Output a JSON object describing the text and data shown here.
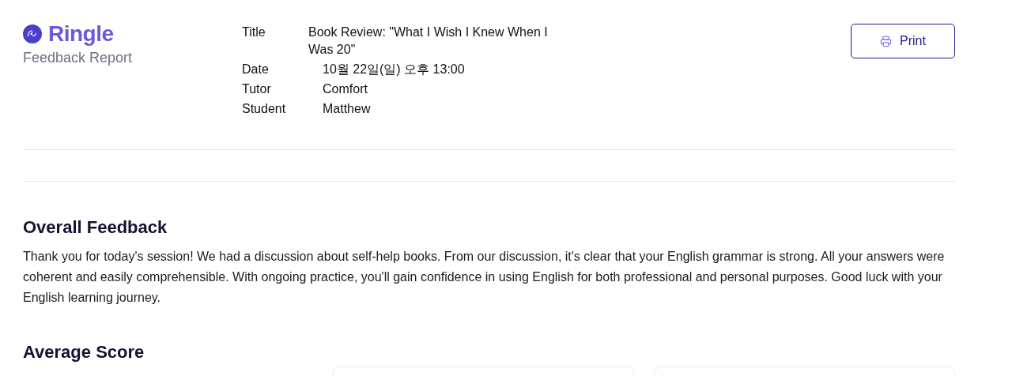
{
  "brand": {
    "name": "Ringle",
    "subtitle": "Feedback Report"
  },
  "meta": [
    {
      "label": "Title",
      "value": "Book Review: \"What I Wish I Knew When I Was 20\""
    },
    {
      "label": "Date",
      "value": "10월 22일(일) 오후 13:00"
    },
    {
      "label": "Tutor",
      "value": "Comfort"
    },
    {
      "label": "Student",
      "value": "Matthew"
    }
  ],
  "print_button": {
    "label": "Print"
  },
  "overall_feedback": {
    "heading": "Overall Feedback",
    "text": "Thank you for today's session! We had a discussion about self-help books. From our discussion, it's clear that your English grammar is strong. All your answers were coherent and easily comprehensible. With ongoing practice, you'll gain confidence in using English for both professional and personal purposes. Good luck with your English learning journey."
  },
  "average_score": {
    "heading": "Average Score"
  }
}
